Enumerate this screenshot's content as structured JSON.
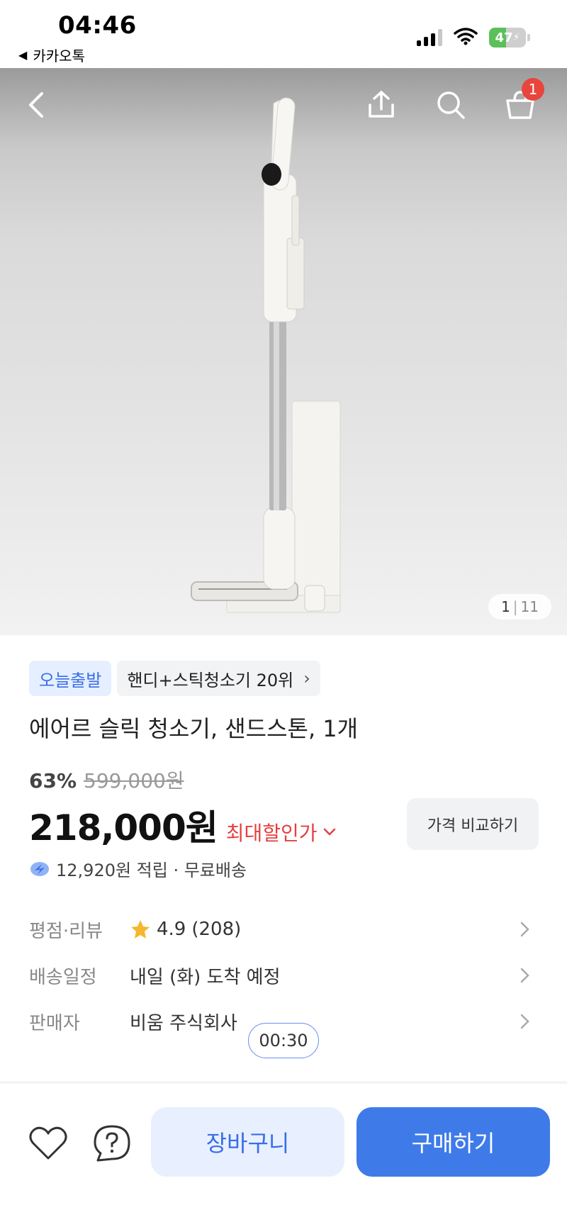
{
  "status_bar": {
    "time": "04:46",
    "back_app": "카카오톡",
    "battery_level": "47",
    "battery_color": "#5ac05a"
  },
  "hero": {
    "image": "cordless stick vacuum cleaner",
    "cart_count": "1",
    "image_index": "1",
    "image_total": "11"
  },
  "product": {
    "tag_delivery": "오늘출발",
    "tag_rank": "핸디+스틱청소기 20위",
    "title": "에어르 슬릭 청소기, 샌드스톤, 1개",
    "discount": "63%",
    "original_price": "599,000원",
    "price": "218,000원",
    "max_discount_label": "최대할인가",
    "compare_label": "가격 비교하기",
    "points": "12,920원 적립 · 무료배송"
  },
  "info": {
    "rating_label": "평점·리뷰",
    "rating": "4.9",
    "review_count": "(208)",
    "shipping_label": "배송일정",
    "shipping_value": "내일 (화) 도착 예정",
    "seller_label": "판매자",
    "seller_value": "비움 주식회사"
  },
  "timer": "00:30",
  "bottom": {
    "cart_label": "장바구니",
    "buy_label": "구매하기"
  },
  "colors": {
    "accent": "#3f7be8",
    "sale": "#e34040",
    "star": "#f5b72e"
  }
}
